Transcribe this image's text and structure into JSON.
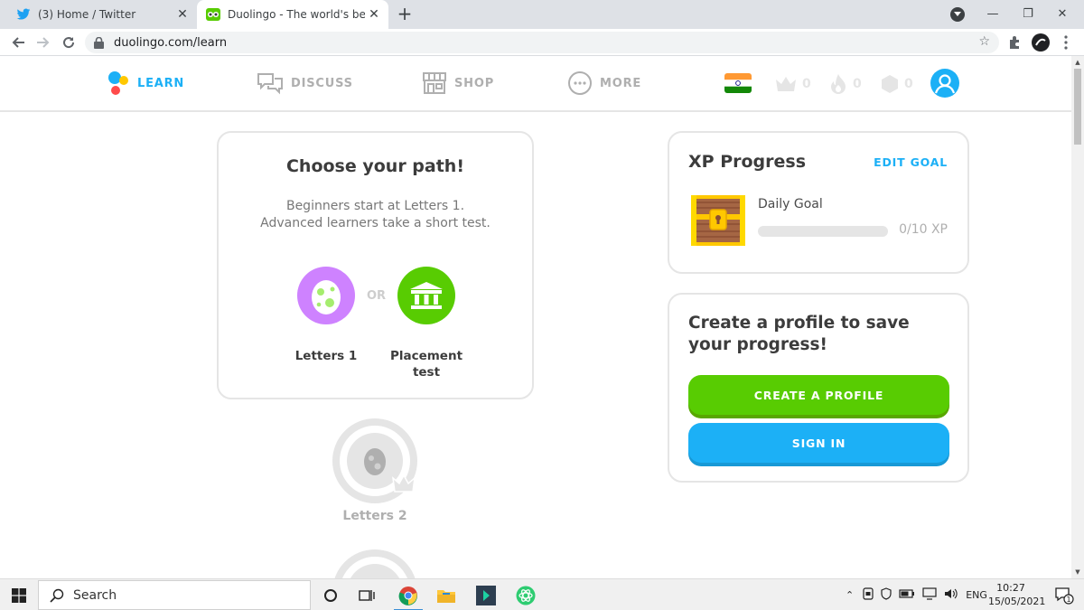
{
  "browser": {
    "tabs": [
      {
        "title": "(3) Home / Twitter",
        "icon": "twitter-bird-icon"
      },
      {
        "title": "Duolingo - The world's best way",
        "icon": "duolingo-owl-icon"
      }
    ],
    "url": "duolingo.com/learn"
  },
  "header": {
    "nav": [
      {
        "label": "LEARN",
        "icon": "learn-icon"
      },
      {
        "label": "DISCUSS",
        "icon": "discuss-icon"
      },
      {
        "label": "SHOP",
        "icon": "shop-icon"
      },
      {
        "label": "MORE",
        "icon": "more-icon"
      }
    ],
    "stats": {
      "crowns": "0",
      "streak": "0",
      "gems": "0"
    },
    "flag": "india-flag-icon"
  },
  "path_card": {
    "title": "Choose your path!",
    "subtitle_line1": "Beginners start at Letters 1.",
    "subtitle_line2": "Advanced learners take a short test.",
    "or_label": "OR",
    "option1": "Letters 1",
    "option2_line1": "Placement",
    "option2_line2": "test"
  },
  "skills": {
    "locked1": "Letters 2"
  },
  "xp_card": {
    "title": "XP Progress",
    "edit_goal": "EDIT GOAL",
    "daily_goal": "Daily Goal",
    "xp_count": "0/10 XP",
    "progress_fraction": 0
  },
  "profile_card": {
    "title": "Create a profile to save your progress!",
    "create_button": "CREATE A PROFILE",
    "signin_button": "SIGN IN"
  },
  "taskbar": {
    "search_placeholder": "Search",
    "language": "ENG",
    "time": "10:27",
    "date": "15/05/2021",
    "notification_count": "1"
  },
  "colors": {
    "duo_blue": "#1cb0f6",
    "duo_green": "#58cc02",
    "egg_purple": "#ce82ff",
    "gray": "#afafaf"
  }
}
